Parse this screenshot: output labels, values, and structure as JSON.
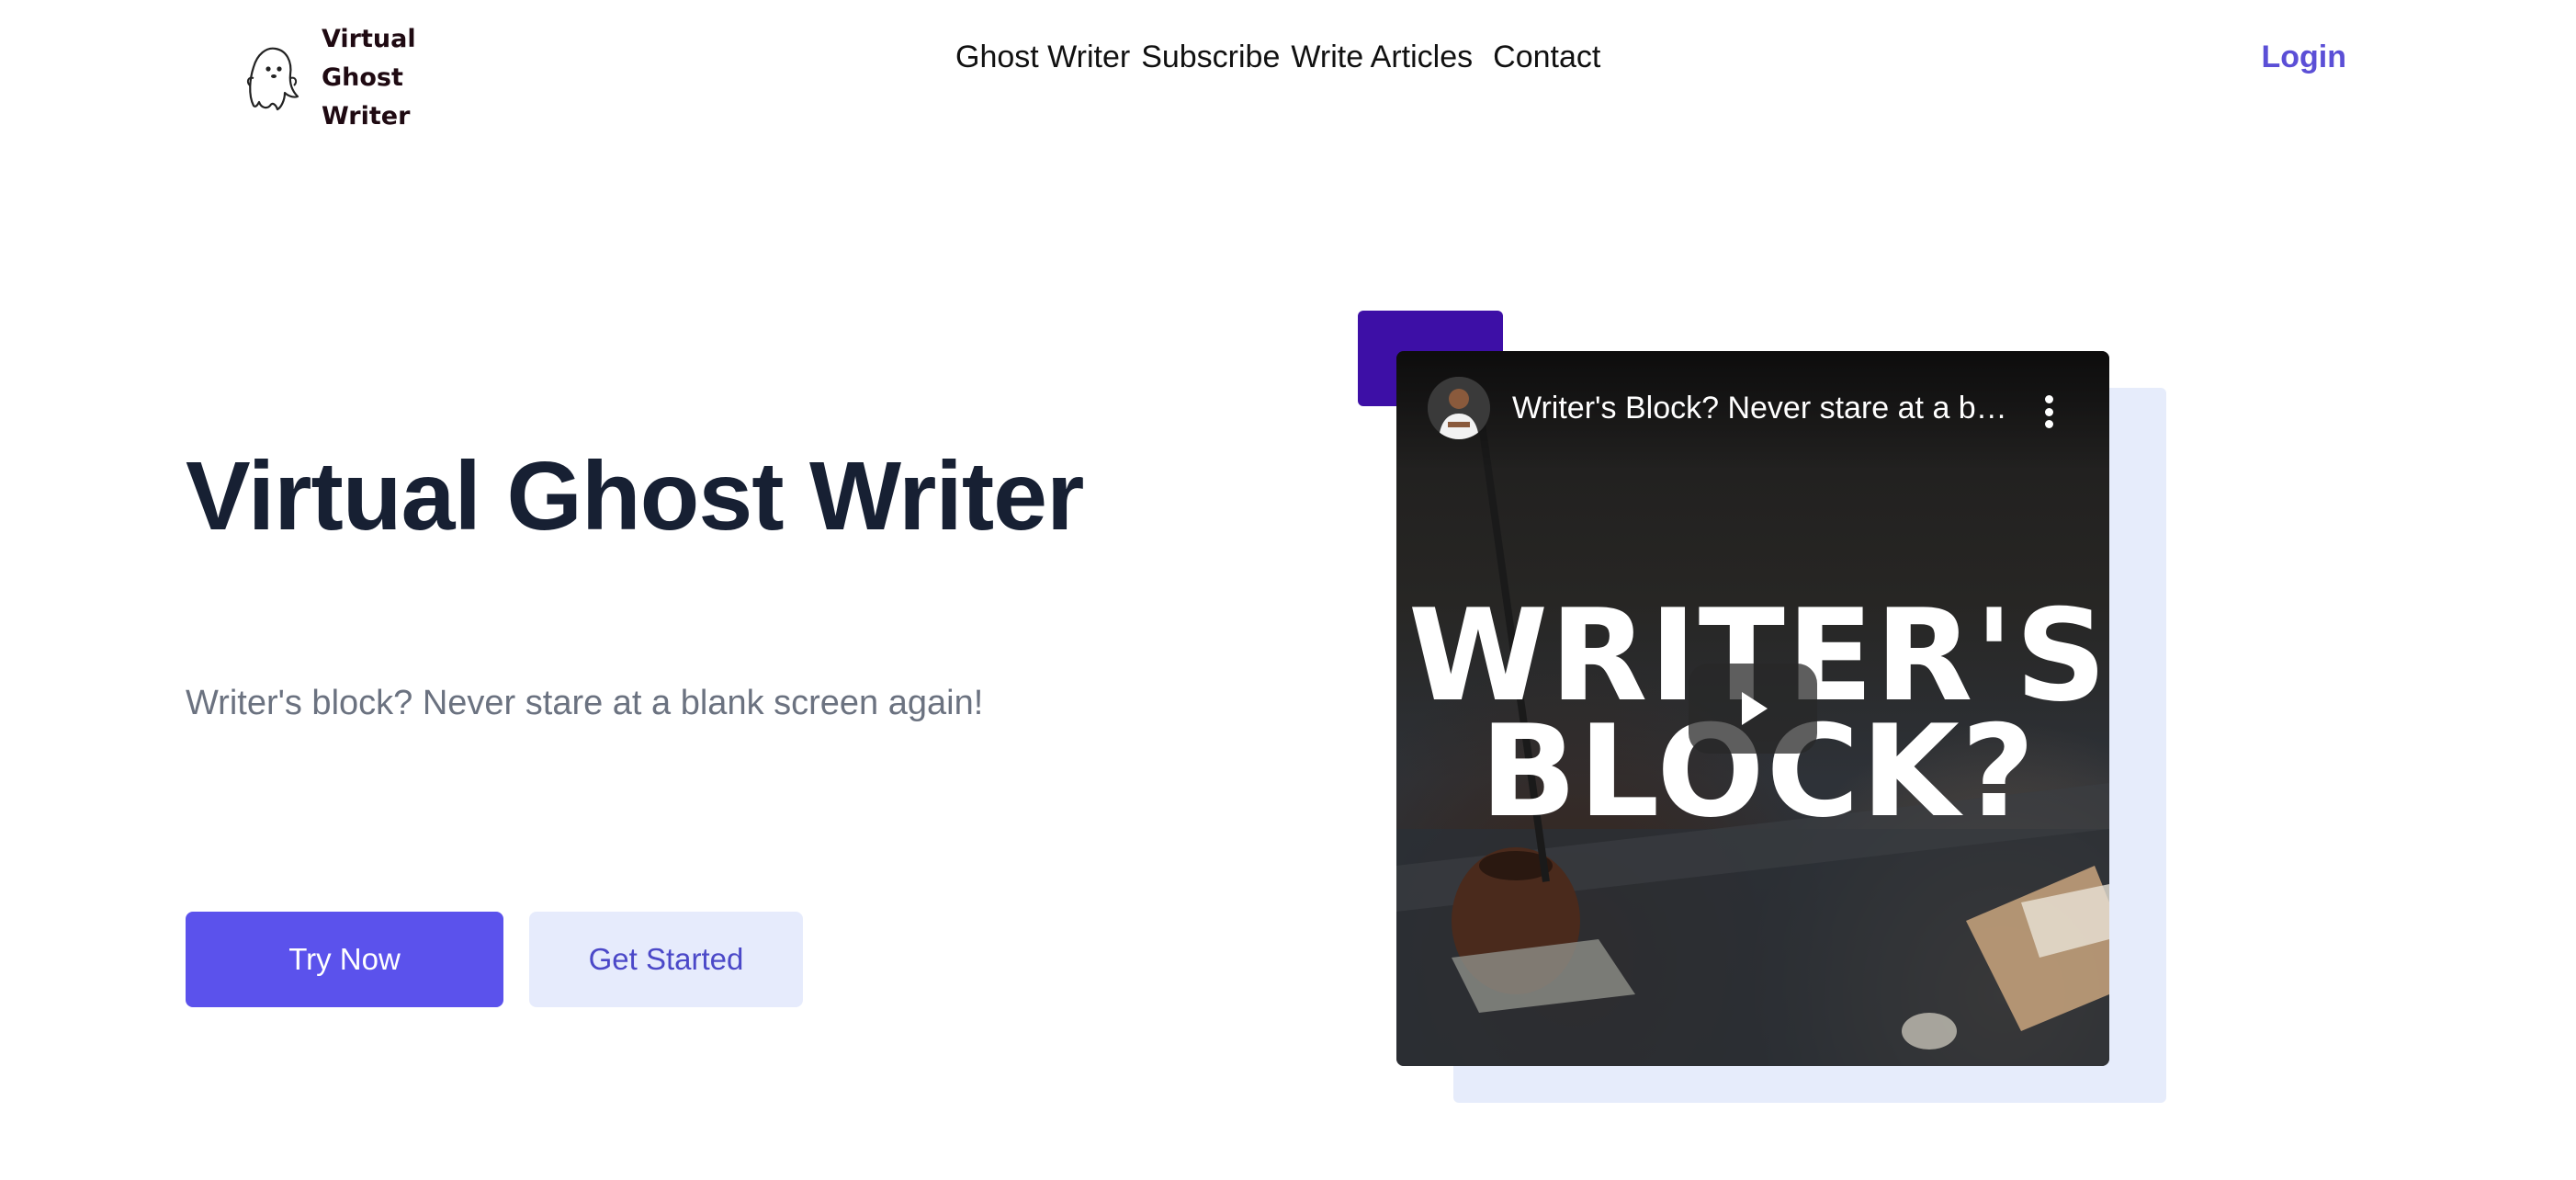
{
  "brand": {
    "name": "Virtual Ghost Writer",
    "logo_icon": "ghost-icon"
  },
  "nav": {
    "items": [
      {
        "label": "Ghost Writer"
      },
      {
        "label": "Subscribe"
      },
      {
        "label": "Write Articles"
      },
      {
        "label": "Contact"
      }
    ],
    "login_label": "Login"
  },
  "hero": {
    "title": "Virtual Ghost Writer",
    "subtitle": "Writer's block? Never stare at a blank screen again!",
    "primary_cta": "Try Now",
    "secondary_cta": "Get Started"
  },
  "video": {
    "title": "Writer's Block? Never stare at a blank screen again!",
    "thumbnail_text_line1": "WRITER'S",
    "thumbnail_text_line2": "BLOCK?",
    "icons": {
      "avatar": "channel-avatar",
      "menu": "more-vertical-icon",
      "play": "play-icon"
    }
  },
  "colors": {
    "accent": "#5b52ec",
    "accent_light": "#e6ebfc",
    "login": "#5b4fd6",
    "title": "#172033",
    "subtitle": "#6b7280",
    "accent_square": "#3d0fa6",
    "back_panel": "#e6ecfb"
  }
}
